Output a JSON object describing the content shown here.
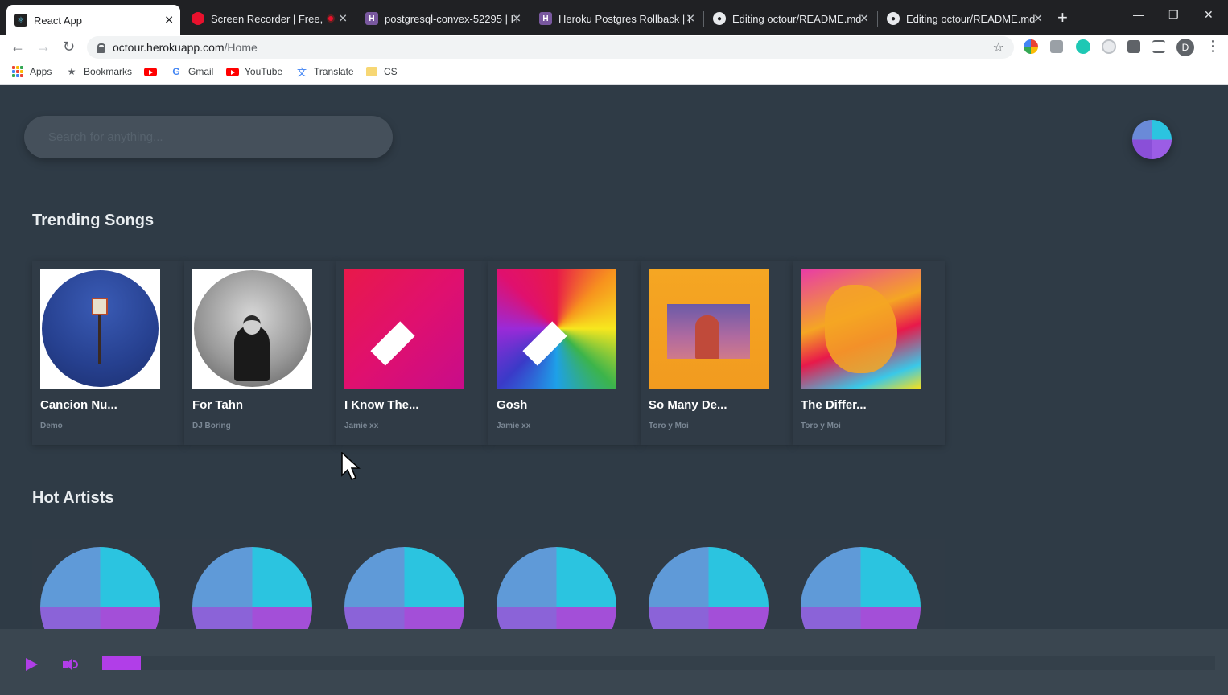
{
  "browser": {
    "tabs": [
      {
        "title": "React App",
        "active": true
      },
      {
        "title": "Screen Recorder | Free, P",
        "active": false
      },
      {
        "title": "postgresql-convex-52295 | H",
        "active": false
      },
      {
        "title": "Heroku Postgres Rollback | H",
        "active": false
      },
      {
        "title": "Editing octour/README.md",
        "active": false
      },
      {
        "title": "Editing octour/README.md",
        "active": false
      }
    ],
    "url_host": "octour.herokuapp.com",
    "url_path": "/Home",
    "profile_initial": "D",
    "bookmarks": [
      "Apps",
      "Bookmarks",
      "Gmail",
      "YouTube",
      "Translate",
      "CS"
    ]
  },
  "app": {
    "search_placeholder": "Search for anything...",
    "trending_title": "Trending Songs",
    "songs": [
      {
        "title": "Cancion Nu...",
        "artist": "Demo"
      },
      {
        "title": "For Tahn",
        "artist": "DJ Boring"
      },
      {
        "title": "I Know The...",
        "artist": "Jamie xx"
      },
      {
        "title": "Gosh",
        "artist": "Jamie xx"
      },
      {
        "title": "So Many De...",
        "artist": "Toro y Moi"
      },
      {
        "title": "The Differ...",
        "artist": "Toro y Moi"
      }
    ],
    "hot_artists_title": "Hot Artists",
    "artist_count": 6
  },
  "player": {
    "progress_fraction": 0.035,
    "accent_color": "#b13ee8"
  },
  "colors": {
    "background": "#2f3b46",
    "card": "#303b46",
    "accent": "#b13ee8"
  }
}
